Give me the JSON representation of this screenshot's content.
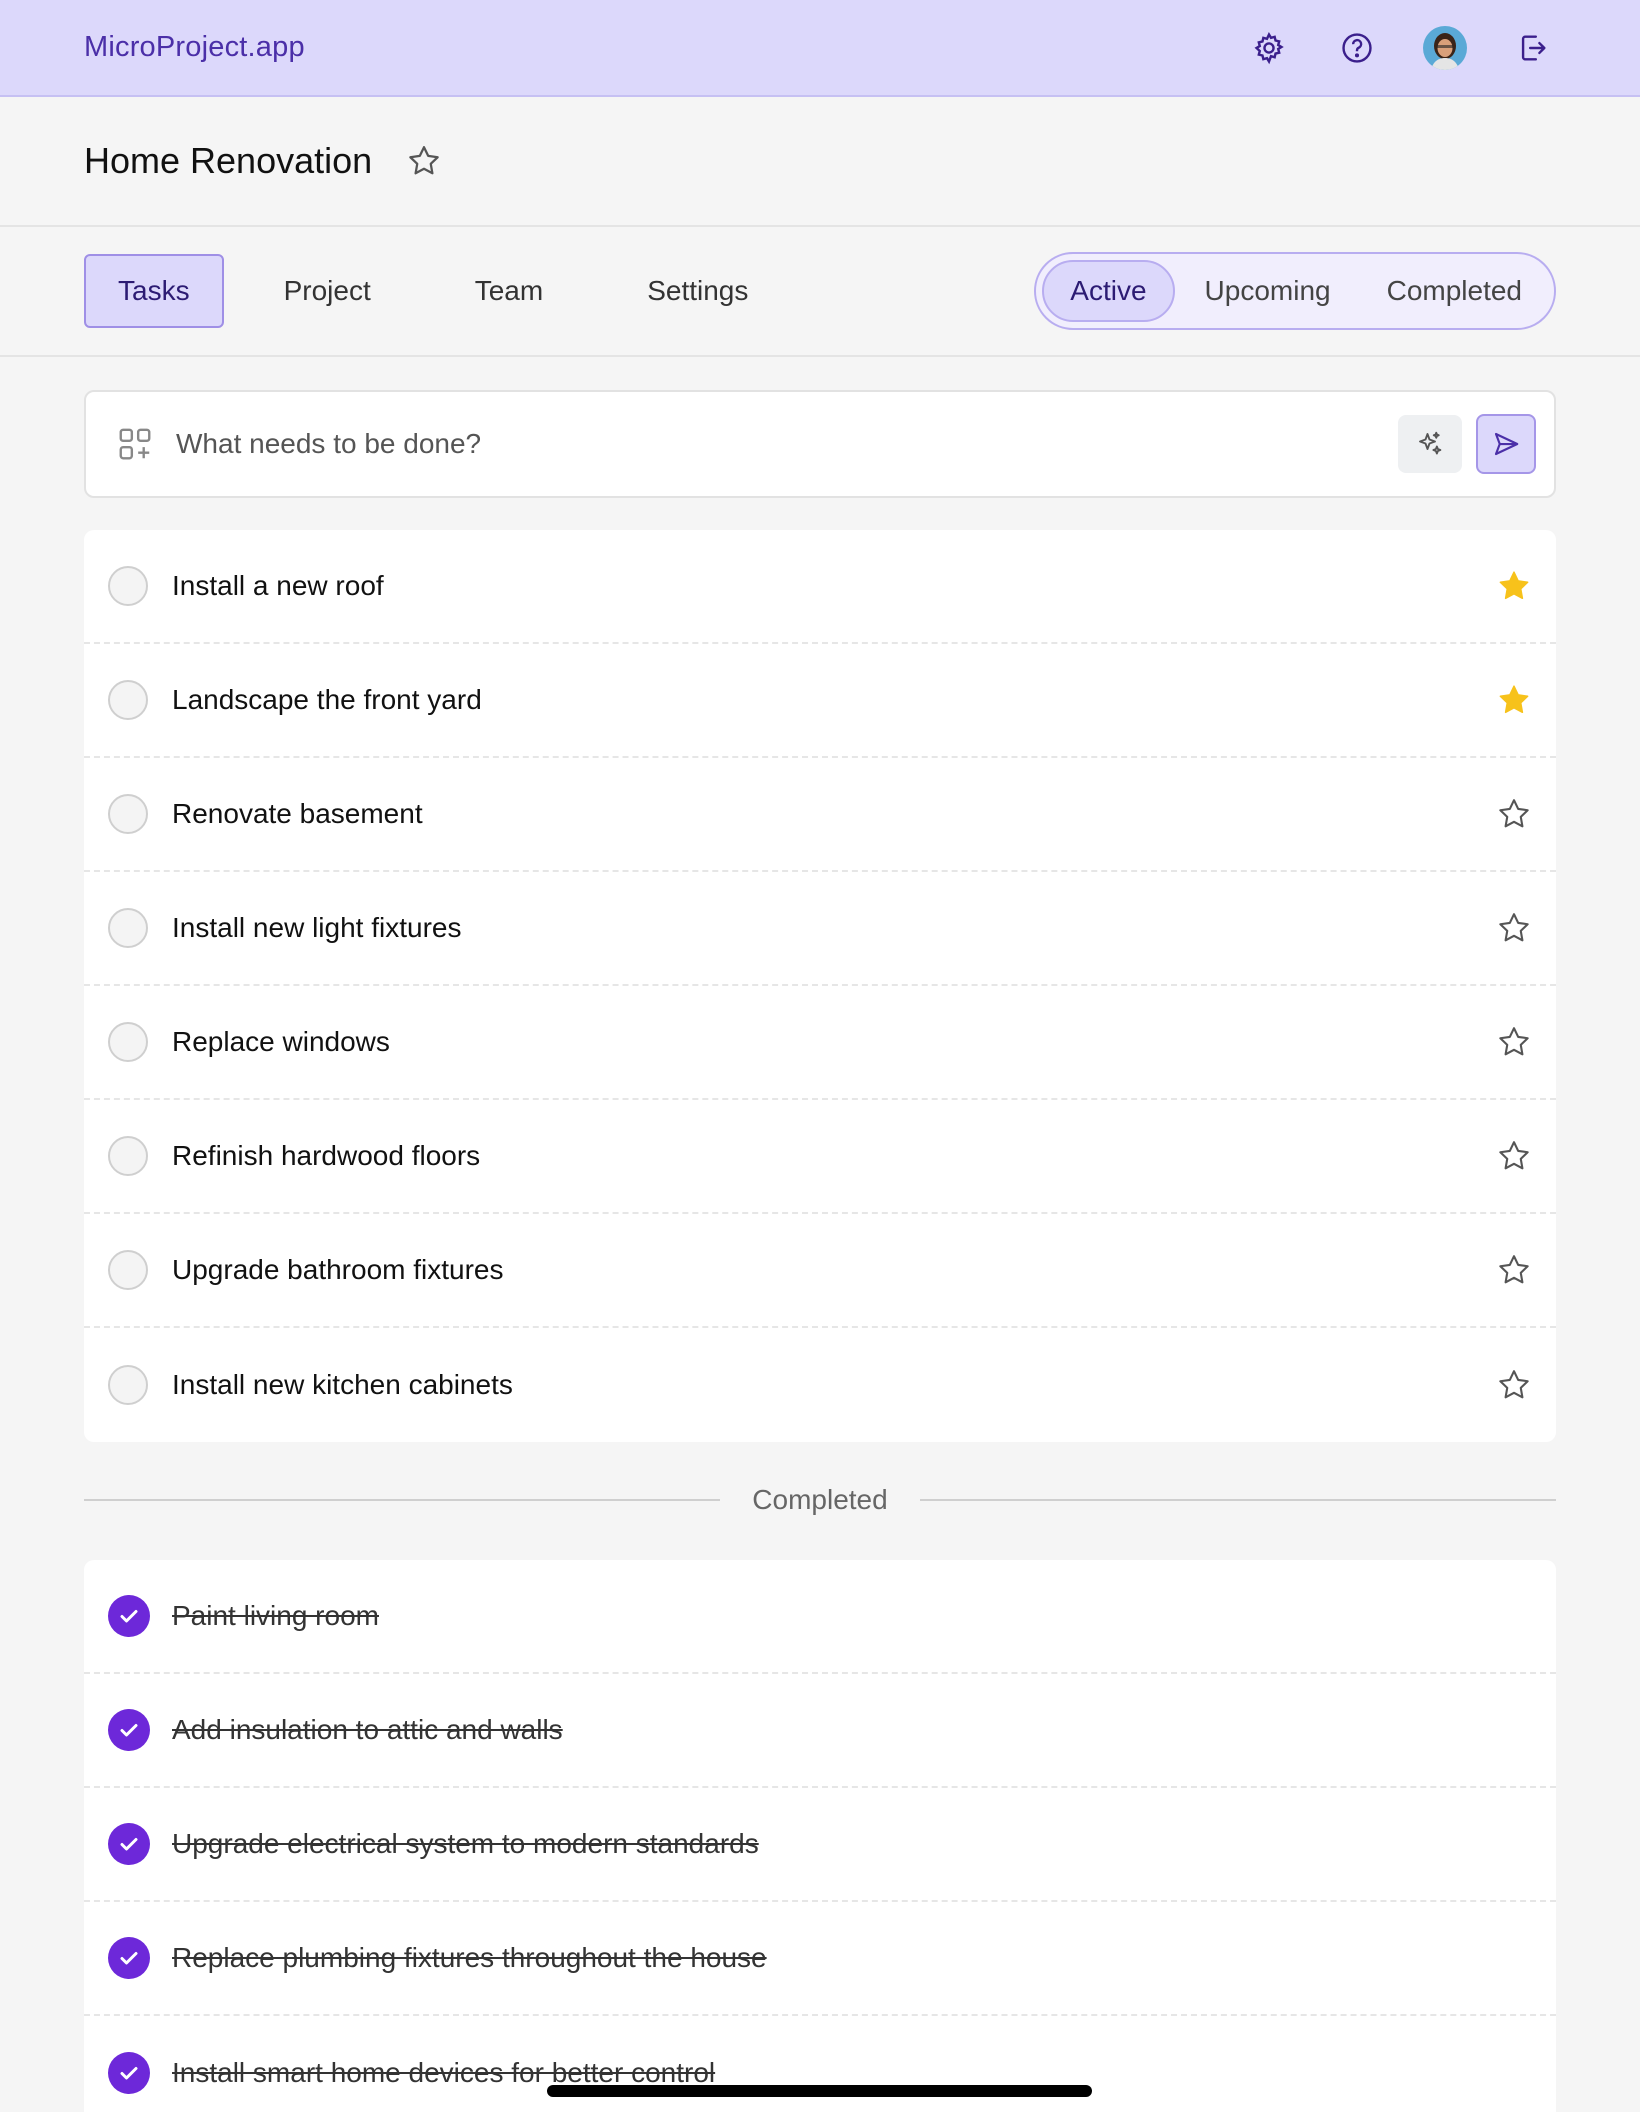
{
  "app": {
    "brand": "MicroProject.app"
  },
  "header_icons": [
    "gear-icon",
    "help-icon",
    "avatar",
    "logout-icon"
  ],
  "page": {
    "title": "Home Renovation"
  },
  "tabs": [
    {
      "label": "Tasks",
      "active": true
    },
    {
      "label": "Project",
      "active": false
    },
    {
      "label": "Team",
      "active": false
    },
    {
      "label": "Settings",
      "active": false
    }
  ],
  "filters": [
    {
      "label": "Active",
      "active": true
    },
    {
      "label": "Upcoming",
      "active": false
    },
    {
      "label": "Completed",
      "active": false
    }
  ],
  "composer": {
    "placeholder": "What needs to be done?"
  },
  "active_tasks": [
    {
      "label": "Install a new roof",
      "starred": true
    },
    {
      "label": "Landscape the front yard",
      "starred": true
    },
    {
      "label": "Renovate basement",
      "starred": false
    },
    {
      "label": "Install new light fixtures",
      "starred": false
    },
    {
      "label": "Replace windows",
      "starred": false
    },
    {
      "label": "Refinish hardwood floors",
      "starred": false
    },
    {
      "label": "Upgrade bathroom fixtures",
      "starred": false
    },
    {
      "label": "Install new kitchen cabinets",
      "starred": false
    }
  ],
  "completed_section": {
    "label": "Completed"
  },
  "completed_tasks": [
    {
      "label": "Paint living room"
    },
    {
      "label": "Add insulation to attic and walls"
    },
    {
      "label": "Upgrade electrical system to modern standards"
    },
    {
      "label": "Replace plumbing fixtures throughout the house"
    },
    {
      "label": "Install smart home devices for better control"
    }
  ],
  "colors": {
    "header_bg": "#dcd8fb",
    "accent": "#6d28d9",
    "star_filled": "#f7c21b",
    "brand_text": "#4b2fa8"
  }
}
